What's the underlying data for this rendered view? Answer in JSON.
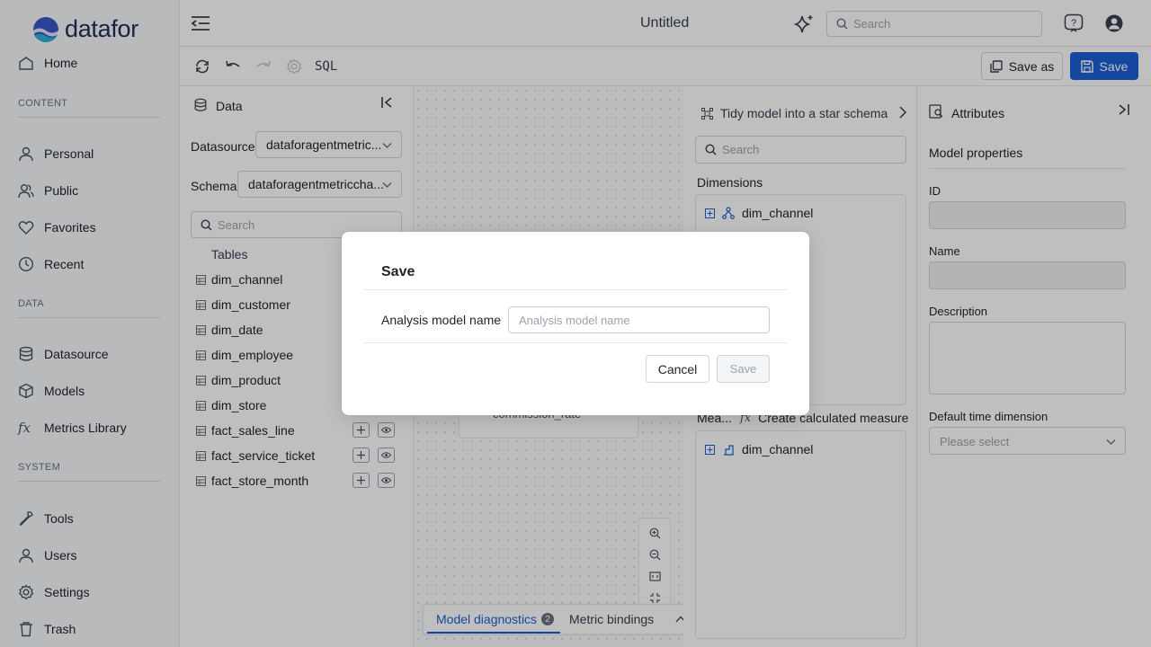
{
  "app": {
    "logo_text": "datafor",
    "title": "Untitled"
  },
  "header": {
    "search_placeholder": "Search",
    "icons": [
      "sparkle-icon",
      "help-icon",
      "user-avatar-icon"
    ]
  },
  "sidebar": {
    "home_label": "Home",
    "sections": {
      "content": "CONTENT",
      "data": "DATA",
      "system": "SYSTEM"
    },
    "content_items": [
      {
        "label": "Personal",
        "icon": "person-icon"
      },
      {
        "label": "Public",
        "icon": "group-icon"
      },
      {
        "label": "Favorites",
        "icon": "heart-icon"
      },
      {
        "label": "Recent",
        "icon": "clock-icon"
      }
    ],
    "data_items": [
      {
        "label": "Datasource",
        "icon": "database-icon"
      },
      {
        "label": "Models",
        "icon": "cube-icon"
      },
      {
        "label": "Metrics Library",
        "icon": "fx-icon"
      }
    ],
    "system_items": [
      {
        "label": "Tools",
        "icon": "wrench-icon"
      },
      {
        "label": "Users",
        "icon": "users-icon"
      },
      {
        "label": "Settings",
        "icon": "gear-icon"
      },
      {
        "label": "Trash",
        "icon": "trash-icon"
      }
    ]
  },
  "toolbar": {
    "sql_label": "SQL",
    "save_as_label": "Save as",
    "save_label": "Save"
  },
  "data_panel": {
    "title": "Data",
    "datasource_label": "Datasource",
    "datasource_value": "dataforagentmetric...",
    "schema_label": "Schema",
    "schema_value": "dataforagentmetriccha...",
    "search_placeholder": "Search",
    "tables_header": "Tables",
    "tables": [
      "dim_channel",
      "dim_customer",
      "dim_date",
      "dim_employee",
      "dim_product",
      "dim_store",
      "fact_sales_line",
      "fact_service_ticket",
      "fact_store_month"
    ]
  },
  "canvas": {
    "node_field": "commission_rate",
    "tabs": {
      "diagnostics": "Model diagnostics",
      "diagnostics_count": "2",
      "bindings": "Metric bindings"
    }
  },
  "model_panel": {
    "tidy_label": "Tidy model into a star schema",
    "search_placeholder": "Search",
    "dimensions_header": "Dimensions",
    "dimension_item": "dim_channel",
    "measures_header": "Mea...",
    "calc_measure_label": "Create calculated measure",
    "measure_item": "dim_channel"
  },
  "attributes": {
    "title": "Attributes",
    "section_title": "Model properties",
    "id_label": "ID",
    "name_label": "Name",
    "description_label": "Description",
    "default_time_label": "Default time dimension",
    "default_time_placeholder": "Please select"
  },
  "dialog": {
    "title": "Save",
    "field_label": "Analysis model name",
    "field_placeholder": "Analysis model name",
    "field_value": "",
    "cancel_label": "Cancel",
    "save_label": "Save"
  },
  "colors": {
    "brand": "#1e2d5a",
    "primary": "#1c5fd6",
    "overlay": "rgba(0,0,0,0.25)"
  }
}
